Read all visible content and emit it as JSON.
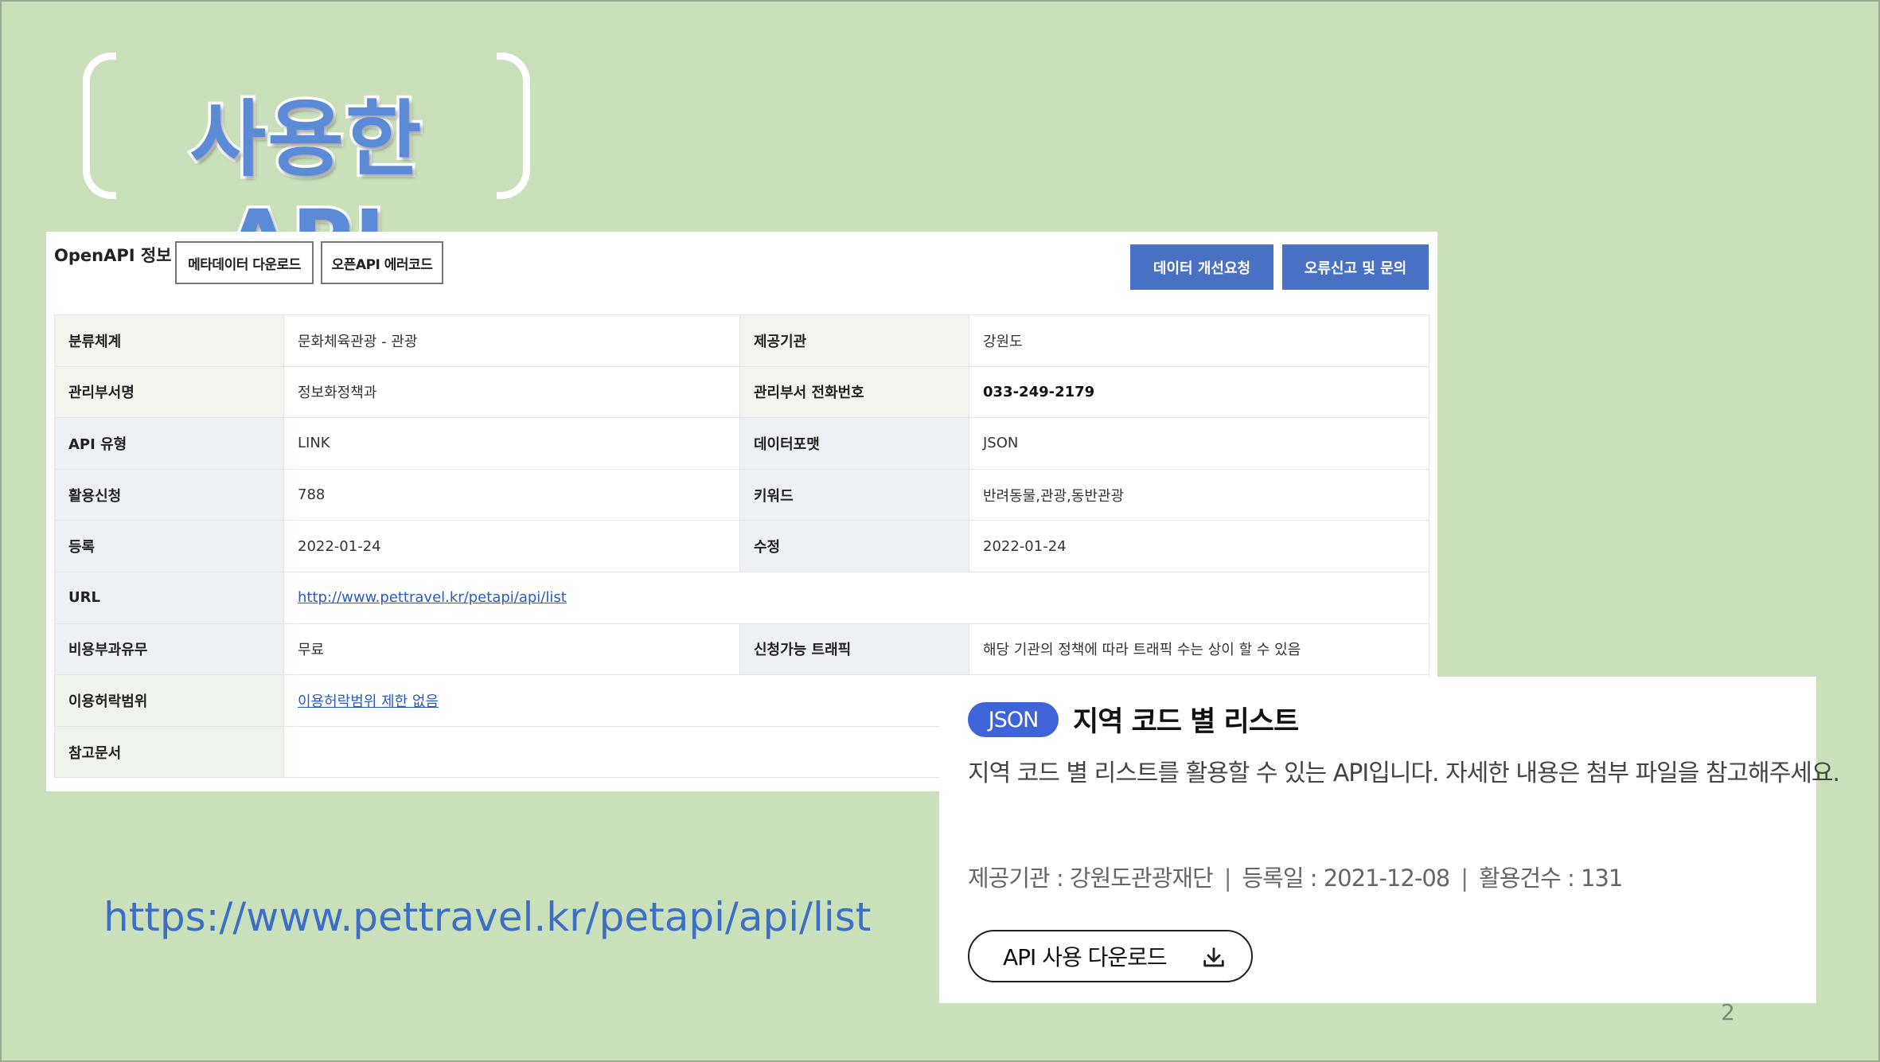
{
  "slide": {
    "title": "사용한 API",
    "url_text": "https://www.pettravel.kr/petapi/api/list",
    "page_number": "2"
  },
  "openapi_panel": {
    "header": "OpenAPI 정보",
    "buttons": {
      "metadata_download": "메타데이터 다운로드",
      "openapi_error_code": "오픈API 에러코드",
      "data_improvement": "데이터 개선요청",
      "error_report": "오류신고 및 문의"
    },
    "rows": [
      {
        "k1": "분류체계",
        "v1": "문화체육관광 - 관광",
        "k2": "제공기관",
        "v2": "강원도"
      },
      {
        "k1": "관리부서명",
        "v1": "정보화정책과",
        "k2": "관리부서 전화번호",
        "v2": "033-249-2179"
      },
      {
        "k1": "API 유형",
        "v1": "LINK",
        "k2": "데이터포맷",
        "v2": "JSON"
      },
      {
        "k1": "활용신청",
        "v1": "788",
        "k2": "키워드",
        "v2": "반려동물,관광,동반관광"
      },
      {
        "k1": "등록",
        "v1": "2022-01-24",
        "k2": "수정",
        "v2": "2022-01-24"
      },
      {
        "k1": "URL",
        "v1": "http://www.pettravel.kr/petapi/api/list"
      },
      {
        "k1": "비용부과유무",
        "v1": "무료",
        "k2": "신청가능 트래픽",
        "v2": "해당 기관의 정책에 따라 트래픽 수는 상이 할 수 있음"
      },
      {
        "k1": "이용허락범위",
        "v1": "이용허락범위 제한 없음"
      },
      {
        "k1": "참고문서",
        "v1": ""
      }
    ]
  },
  "json_card": {
    "badge": "JSON",
    "title": "지역 코드 별 리스트",
    "description": "지역 코드 별 리스트를 활용할 수 있는 API입니다. 자세한 내용은 첨부 파일을 참고해주세요.",
    "provider": "제공기관 : 강원도관광재단",
    "registered": "등록일 : 2021-12-08",
    "usage_count": "활용건수 : 131",
    "separator": "|",
    "download_button": "API 사용 다운로드",
    "download_icon": "download-icon"
  }
}
